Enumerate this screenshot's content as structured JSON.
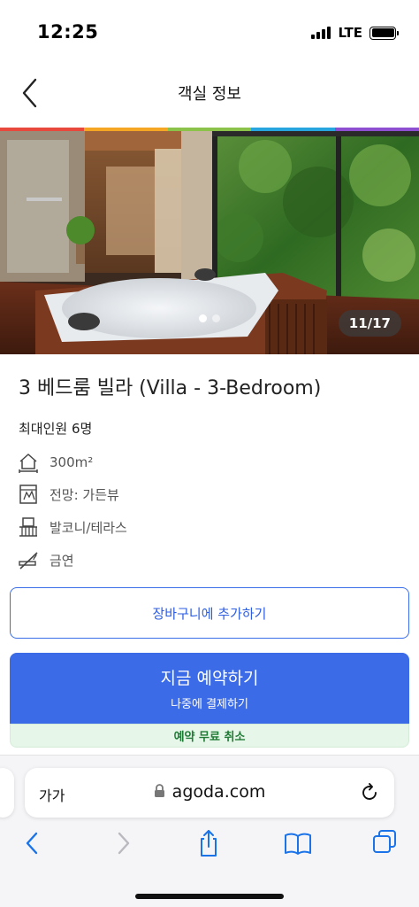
{
  "status": {
    "time": "12:25",
    "network": "LTE"
  },
  "header": {
    "title": "객실 정보",
    "back_icon": "chevron-left-icon"
  },
  "brand_stripe": [
    "#e8473c",
    "#f5a623",
    "#8bc34a",
    "#27a5de",
    "#8e4fd1"
  ],
  "gallery": {
    "counter": "11/17",
    "dots_total": 2,
    "dots_active": 1
  },
  "room": {
    "title": "3 베드룸 빌라 (Villa - 3-Bedroom)",
    "occupancy": "최대인원 6명",
    "amenities": [
      {
        "icon": "house-size-icon",
        "label": "300m²"
      },
      {
        "icon": "window-view-icon",
        "label": "전망: 가든뷰"
      },
      {
        "icon": "balcony-icon",
        "label": "발코니/테라스"
      },
      {
        "icon": "no-smoking-icon",
        "label": "금연"
      }
    ]
  },
  "actions": {
    "cart_label": "장바구니에 추가하기",
    "book_label": "지금 예약하기",
    "book_sub": "나중에 결제하기",
    "free_cancel": "예약 무료 취소"
  },
  "browser": {
    "text_size_label": "가가",
    "url": "agoda.com",
    "toolbar_icons": [
      "back-icon",
      "forward-icon",
      "share-icon",
      "bookmarks-icon",
      "tabs-icon"
    ]
  },
  "colors": {
    "accent": "#3b6be6",
    "free_cancel_bg": "#e6f6e8",
    "free_cancel_text": "#1f7a35"
  }
}
